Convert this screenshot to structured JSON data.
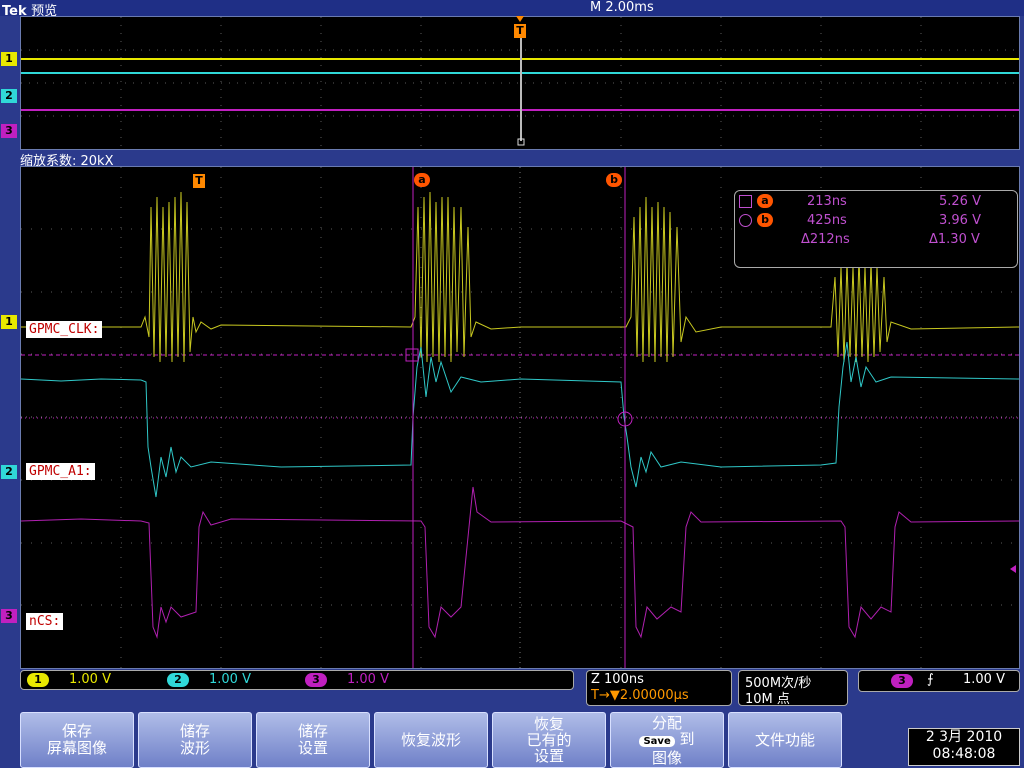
{
  "header": {
    "brand": "Tek",
    "mode": "预览",
    "timebase": "M 2.00ms"
  },
  "zoom": {
    "label": "缩放系数: 20kX"
  },
  "markers": {
    "trigger": "T",
    "cursor_a": "a",
    "cursor_b": "b"
  },
  "channels": [
    {
      "num": "1",
      "color": "#e8e800",
      "signal": "GPMC_CLK:",
      "scale": "1.00 V"
    },
    {
      "num": "2",
      "color": "#30d8d8",
      "signal": "GPMC_A1:",
      "scale": "1.00 V"
    },
    {
      "num": "3",
      "color": "#c020c0",
      "signal": "nCS:",
      "scale": "1.00 V"
    }
  ],
  "readout": {
    "a_label": "a",
    "a_time": "213ns",
    "a_volt": "5.26 V",
    "b_label": "b",
    "b_time": "425ns",
    "b_volt": "3.96 V",
    "delta_time": "Δ212ns",
    "delta_volt": "Δ1.30 V"
  },
  "zoom_info": {
    "z": "Z 100ns",
    "trigger_pos": "T→▼2.00000μs"
  },
  "sample_info": {
    "rate": "500M次/秒",
    "points": "10M 点"
  },
  "trigger_info": {
    "ch": "3",
    "slope": "⨍",
    "level": "1.00 V"
  },
  "softkeys": [
    {
      "line1": "保存",
      "line2": "屏幕图像"
    },
    {
      "line1": "储存",
      "line2": "波形"
    },
    {
      "line1": "储存",
      "line2": "设置"
    },
    {
      "line1": "恢复波形",
      "line2": ""
    },
    {
      "line1": "恢复",
      "line2": "已有的",
      "line3": "设置"
    },
    {
      "line1": "分配",
      "save": "Save",
      "line2": "到",
      "line3": "图像"
    },
    {
      "line1": "文件功能",
      "line2": ""
    }
  ],
  "datetime": {
    "date": "2 3月 2010",
    "time": "08:48:08"
  },
  "colors": {
    "ch1": "#e8e800",
    "ch2": "#30d8d8",
    "ch3": "#c020c0",
    "marker": "#ff8800",
    "cursor": "#c020c0"
  }
}
